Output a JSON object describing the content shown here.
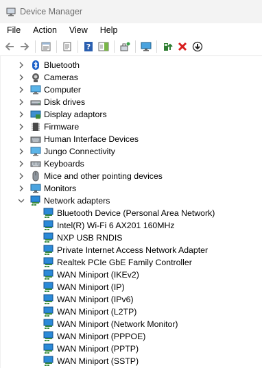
{
  "window": {
    "title": "Device Manager"
  },
  "menu": [
    "File",
    "Action",
    "View",
    "Help"
  ],
  "toolbar": [
    {
      "name": "back-icon"
    },
    {
      "name": "forward-icon"
    },
    {
      "sep": true
    },
    {
      "name": "properties-icon"
    },
    {
      "sep": true
    },
    {
      "name": "update-view-icon"
    },
    {
      "sep": true
    },
    {
      "name": "help-icon"
    },
    {
      "name": "action-pane-icon"
    },
    {
      "sep": true
    },
    {
      "name": "scan-hardware-icon"
    },
    {
      "sep": true
    },
    {
      "name": "monitor-icon"
    },
    {
      "sep": true
    },
    {
      "name": "update-driver-icon"
    },
    {
      "name": "uninstall-icon"
    },
    {
      "name": "disable-device-icon"
    }
  ],
  "tree": {
    "categories": [
      {
        "label": "Bluetooth",
        "icon": "bluetooth-icon",
        "expanded": false
      },
      {
        "label": "Cameras",
        "icon": "camera-icon",
        "expanded": false
      },
      {
        "label": "Computer",
        "icon": "computer-icon",
        "expanded": false
      },
      {
        "label": "Disk drives",
        "icon": "disk-drive-icon",
        "expanded": false
      },
      {
        "label": "Display adaptors",
        "icon": "display-adapter-icon",
        "expanded": false
      },
      {
        "label": "Firmware",
        "icon": "firmware-icon",
        "expanded": false
      },
      {
        "label": "Human Interface Devices",
        "icon": "hid-icon",
        "expanded": false
      },
      {
        "label": "Jungo Connectivity",
        "icon": "jungo-icon",
        "expanded": false
      },
      {
        "label": "Keyboards",
        "icon": "keyboard-icon",
        "expanded": false
      },
      {
        "label": "Mice and other pointing devices",
        "icon": "mouse-icon",
        "expanded": false
      },
      {
        "label": "Monitors",
        "icon": "monitor-icon",
        "expanded": false
      },
      {
        "label": "Network adapters",
        "icon": "network-adapter-icon",
        "expanded": true
      }
    ],
    "network_devices": [
      "Bluetooth Device (Personal Area Network)",
      "Intel(R) Wi-Fi 6 AX201 160MHz",
      "NXP USB RNDIS",
      "Private Internet Access Network Adapter",
      "Realtek PCIe GbE Family Controller",
      "WAN Miniport (IKEv2)",
      "WAN Miniport (IP)",
      "WAN Miniport (IPv6)",
      "WAN Miniport (L2TP)",
      "WAN Miniport (Network Monitor)",
      "WAN Miniport (PPPOE)",
      "WAN Miniport (PPTP)",
      "WAN Miniport (SSTP)"
    ]
  },
  "colors": {
    "accent": "#0078d4",
    "network": "#1e7fd0",
    "titlebar": "#f3f3f3"
  }
}
